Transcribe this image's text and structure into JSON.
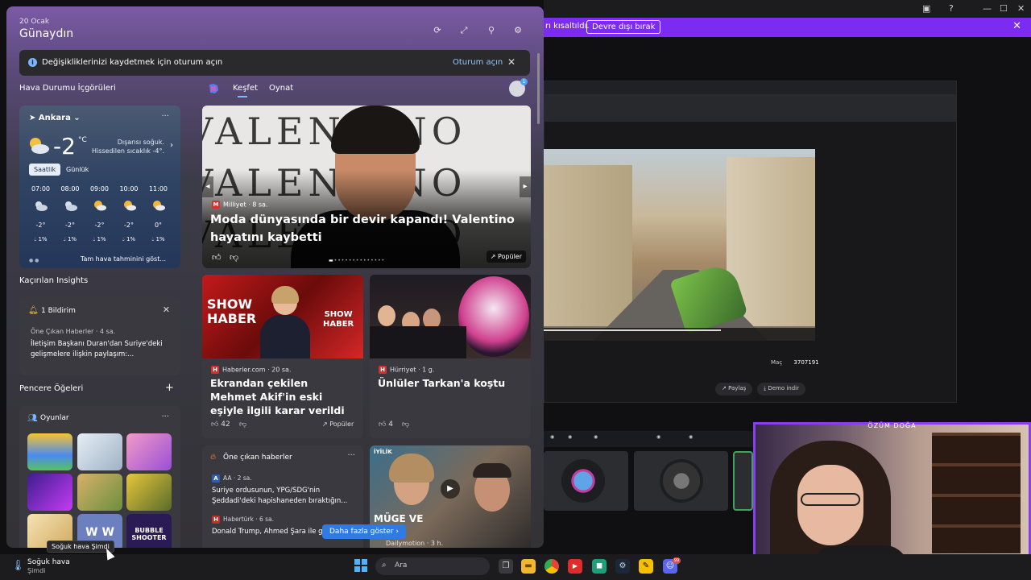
{
  "desktop": {
    "notice_message": "rı kısaltıldı.",
    "notice_button": "Devre dışı bırak",
    "mac_label": "Maç",
    "mac_value": "3707191",
    "share_label": "Paylaş",
    "demo_label": "Demo indir",
    "webcam_name": "ÖZÜM DOĞA"
  },
  "widgets": {
    "date": "20 Ocak",
    "greeting": "Günaydın",
    "header_icons": [
      "refresh-icon",
      "expand-icon",
      "pin-icon",
      "settings-icon"
    ],
    "signin": {
      "message": "Değişikliklerinizi kaydetmek için oturum açın",
      "link": "Oturum açın"
    },
    "weather_section_title": "Hava Durumu İçgörüleri",
    "weather": {
      "city": "Ankara",
      "temp": "-2",
      "unit": "°C",
      "desc_line1": "Dışarısı soğuk.",
      "desc_line2": "Hissedilen sıcaklık -4°.",
      "tab_hourly": "Saatlik",
      "tab_daily": "Günlük",
      "hours": [
        {
          "time": "07:00",
          "temp": "-2°",
          "rain": "1%",
          "icon": "cloudy-night-icon"
        },
        {
          "time": "08:00",
          "temp": "-2°",
          "rain": "1%",
          "icon": "cloudy-night-icon"
        },
        {
          "time": "09:00",
          "temp": "-2°",
          "rain": "1%",
          "icon": "partly-sunny-icon"
        },
        {
          "time": "10:00",
          "temp": "-2°",
          "rain": "1%",
          "icon": "partly-sunny-icon"
        },
        {
          "time": "11:00",
          "temp": "0°",
          "rain": "1%",
          "icon": "partly-sunny-icon"
        }
      ],
      "full_forecast": "Tam hava tahminini göst..."
    },
    "missed_title": "Kaçırılan Insights",
    "notification": {
      "title": "1 Bildirim",
      "source": "Öne Çıkan Haberler · 4 sa.",
      "body": "İletişim Başkanı Duran'dan Suriye'deki gelişmelere ilişkin paylaşım:..."
    },
    "widgets_title": "Pencere Öğeleri",
    "add_symbol": "+",
    "games": {
      "title": "Oyunlar",
      "tile_text": [
        "W",
        "W",
        "BUBBLE",
        "SHOOTER"
      ]
    },
    "feed_tabs": [
      "Keşfet",
      "Oynat"
    ],
    "avatar_badge": "1",
    "hero": {
      "bg_word": "VALENTINO",
      "source": "Milliyet · 8 sa.",
      "title": "Moda dünyasında bir devir kapandı! Valentino hayatını kaybetti",
      "popular": "Popüler"
    },
    "card1": {
      "img_text_1": "SHOW",
      "img_text_2": "HABER",
      "source": "Haberler.com · 20 sa.",
      "headline": "Ekrandan çekilen Mehmet Akif'in eski eşiyle ilgili karar verildi",
      "likes": "42",
      "popular": "Popüler"
    },
    "card2": {
      "source": "Hürriyet · 1 g.",
      "headline": "Ünlüler Tarkan'a koştu",
      "likes": "4"
    },
    "top_news": {
      "title": "Öne çıkan haberler",
      "items": [
        {
          "source": "AA · 2 sa.",
          "headline": "Suriye ordusunun, YPG/SDG'nin Şeddadi'deki hapishaneden bıraktığın..."
        },
        {
          "source": "Habertürk · 6 sa.",
          "headline": "Donald Trump, Ahmed Şara ile g..."
        }
      ]
    },
    "card3": {
      "tag": "İYİLİK",
      "overlay_1": "MÜGE VE",
      "overlay_2": "",
      "source": "Dailymotion · 3 h."
    },
    "show_more": "Daha fazla göster"
  },
  "taskbar": {
    "weather_line1": "Soğuk hava",
    "weather_line2": "Şimdi",
    "tooltip": "Soğuk hava Şimdi",
    "search_label": "Ara",
    "apps": [
      "task-view-icon",
      "file-explorer-icon",
      "chrome-icon",
      "youtube-icon",
      "app-icon",
      "steam-icon",
      "pen-icon",
      "discord-icon"
    ],
    "discord_badge": "99"
  }
}
